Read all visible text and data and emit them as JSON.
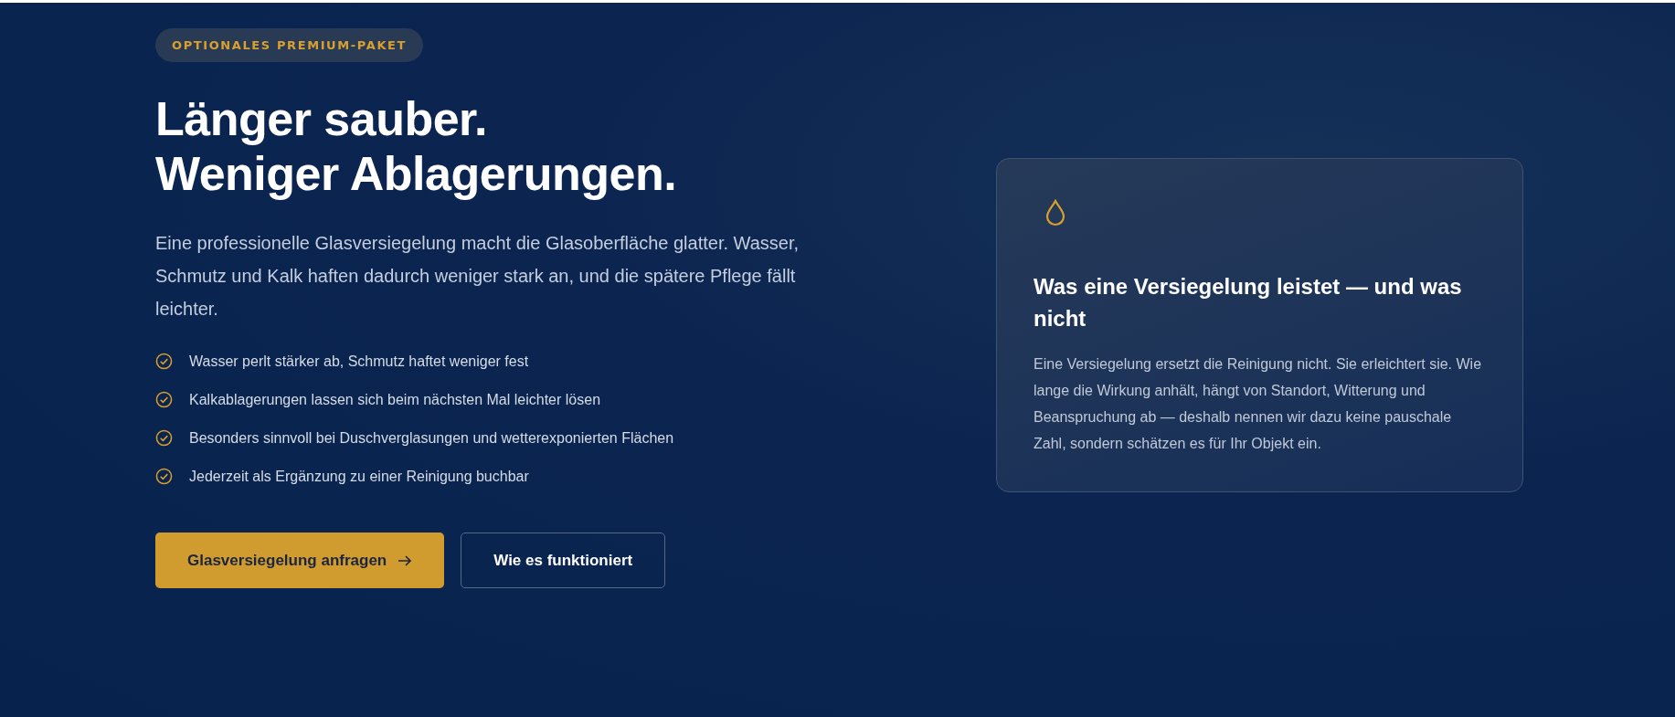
{
  "badge": "OPTIONALES PREMIUM-PAKET",
  "heading_lines": [
    "Länger sauber.",
    "Weniger Ablagerungen."
  ],
  "intro": "Eine professionelle Glasversiegelung macht die Glasoberfläche glatter. Wasser, Schmutz und Kalk haften dadurch weniger stark an, und die spätere Pflege fällt leichter.",
  "benefits": [
    "Wasser perlt stärker ab, Schmutz haftet weniger fest",
    "Kalkablagerungen lassen sich beim nächsten Mal leichter lösen",
    "Besonders sinnvoll bei Duschverglasungen und wetterexponierten Flächen",
    "Jederzeit als Ergänzung zu einer Reinigung buchbar"
  ],
  "buttons": [
    {
      "label": "Glasversiegelung anfragen",
      "kind": "primary"
    },
    {
      "label": "Wie es funktioniert",
      "kind": "secondary"
    }
  ],
  "info_card": {
    "title": "Was eine Versiegelung leistet — und was nicht",
    "text": "Eine Versiegelung ersetzt die Reinigung nicht. Sie erleichtert sie. Wie lange die Wirkung anhält, hängt von Standort, Witterung und Beanspruchung ab — deshalb nennen wir dazu keine pauschale Zahl, sondern schätzen es für Ihr Objekt ein."
  }
}
